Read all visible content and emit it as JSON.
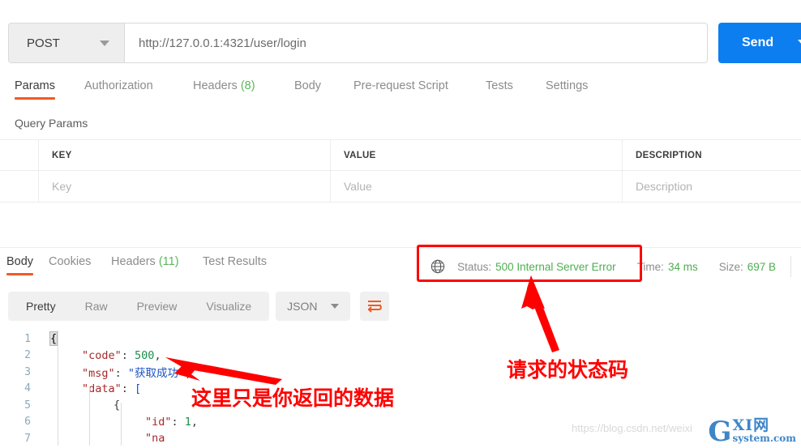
{
  "request": {
    "method": "POST",
    "url": "http://127.0.0.1:4321/user/login",
    "send_label": "Send",
    "tabs": [
      {
        "label": "Params",
        "count": "",
        "active": true
      },
      {
        "label": "Authorization",
        "count": "",
        "active": false
      },
      {
        "label": "Headers",
        "count": "(8)",
        "active": false
      },
      {
        "label": "Body",
        "count": "",
        "active": false
      },
      {
        "label": "Pre-request Script",
        "count": "",
        "active": false
      },
      {
        "label": "Tests",
        "count": "",
        "active": false
      },
      {
        "label": "Settings",
        "count": "",
        "active": false
      }
    ]
  },
  "query_params": {
    "title": "Query Params",
    "headers": [
      "",
      "KEY",
      "VALUE",
      "DESCRIPTION"
    ],
    "rows": [
      {
        "key": "Key",
        "value": "Value",
        "description": "Description"
      }
    ]
  },
  "response": {
    "tabs": [
      {
        "label": "Body",
        "count": "",
        "active": true
      },
      {
        "label": "Cookies",
        "count": "",
        "active": false
      },
      {
        "label": "Headers",
        "count": "(11)",
        "active": false
      },
      {
        "label": "Test Results",
        "count": "",
        "active": false
      }
    ],
    "status": {
      "status_label": "Status:",
      "status_value": "500 Internal Server Error",
      "time_label": "Time:",
      "time_value": "34 ms",
      "size_label": "Size:",
      "size_value": "697 B",
      "value_color": "#4caf50"
    },
    "view_modes": [
      {
        "label": "Pretty",
        "active": true
      },
      {
        "label": "Raw",
        "active": false
      },
      {
        "label": "Preview",
        "active": false
      },
      {
        "label": "Visualize",
        "active": false
      }
    ],
    "format": "JSON",
    "body_lines": [
      {
        "n": "1",
        "indent": 0,
        "segs": [
          {
            "t": "{",
            "c": "brhl"
          }
        ]
      },
      {
        "n": "2",
        "indent": 1,
        "segs": [
          {
            "t": "\"code\"",
            "c": "k"
          },
          {
            "t": ": ",
            "c": "pun"
          },
          {
            "t": "500",
            "c": "num"
          },
          {
            "t": ",",
            "c": "pun"
          }
        ]
      },
      {
        "n": "3",
        "indent": 1,
        "segs": [
          {
            "t": "\"msg\"",
            "c": "k"
          },
          {
            "t": ": ",
            "c": "pun"
          },
          {
            "t": "\"获取成功\"",
            "c": "str"
          },
          {
            "t": ",",
            "c": "pun"
          }
        ]
      },
      {
        "n": "4",
        "indent": 1,
        "segs": [
          {
            "t": "\"data\"",
            "c": "k"
          },
          {
            "t": ": ",
            "c": "pun"
          },
          {
            "t": "[",
            "c": "str"
          }
        ]
      },
      {
        "n": "5",
        "indent": 2,
        "segs": [
          {
            "t": "{",
            "c": "pun"
          }
        ]
      },
      {
        "n": "6",
        "indent": 3,
        "segs": [
          {
            "t": "\"id\"",
            "c": "k"
          },
          {
            "t": ": ",
            "c": "pun"
          },
          {
            "t": "1",
            "c": "num"
          },
          {
            "t": ",",
            "c": "pun"
          }
        ]
      },
      {
        "n": "7",
        "indent": 3,
        "segs": [
          {
            "t": "\"na",
            "c": "k"
          }
        ]
      }
    ]
  },
  "annotations": {
    "data_note": "这里只是你返回的数据",
    "status_note": "请求的状态码",
    "box_color": "#ff0000"
  },
  "watermark": {
    "url": "https://blog.csdn.net/weixi",
    "logo_g": "G",
    "logo_xi": "XI网",
    "logo_sys": "system.com"
  },
  "icons": {
    "globe": "globe-icon",
    "wrap": "wrap-lines-icon"
  }
}
